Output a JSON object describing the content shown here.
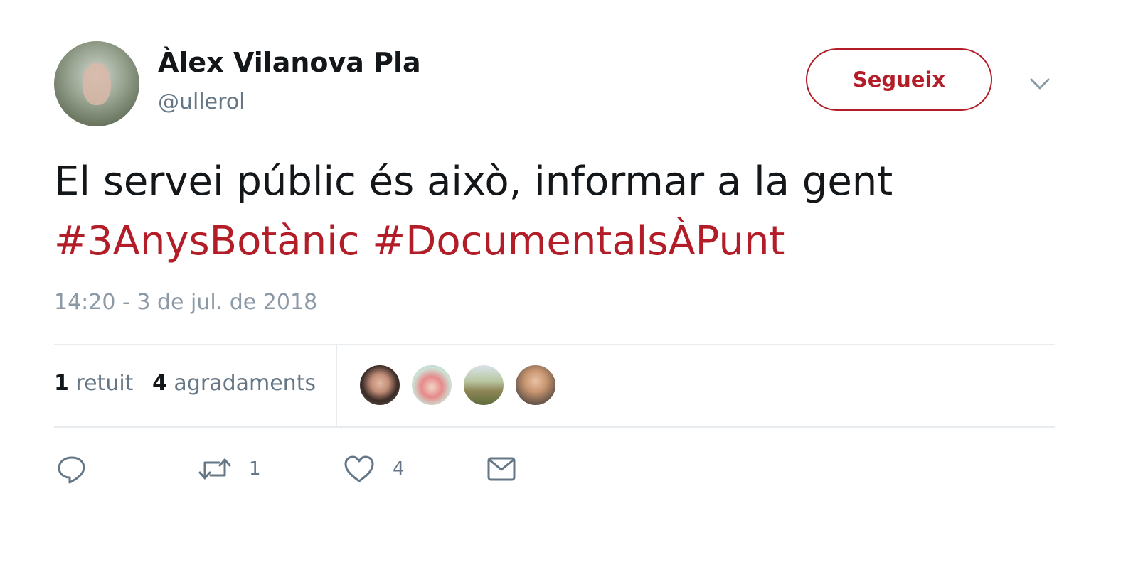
{
  "user": {
    "display_name": "Àlex Vilanova Pla",
    "handle": "@ullerol"
  },
  "follow_button": {
    "label": "Segueix"
  },
  "tweet": {
    "text": "El servei públic és això, informar a la gent",
    "hashtags": [
      "#3AnysBotànic",
      "#DocumentalsÀPunt"
    ],
    "timestamp": "14:20 - 3 de jul. de 2018"
  },
  "stats": {
    "retweets_count": "1",
    "retweets_label": "retuit",
    "likes_count": "4",
    "likes_label": "agradaments"
  },
  "actions": {
    "retweet_count": "1",
    "like_count": "4"
  },
  "colors": {
    "accent": "#b31d28",
    "text": "#14171a",
    "muted": "#657786",
    "divider": "#e6ecf0"
  },
  "icons": [
    "chevron-down-icon",
    "reply-icon",
    "retweet-icon",
    "heart-icon",
    "mail-icon"
  ]
}
